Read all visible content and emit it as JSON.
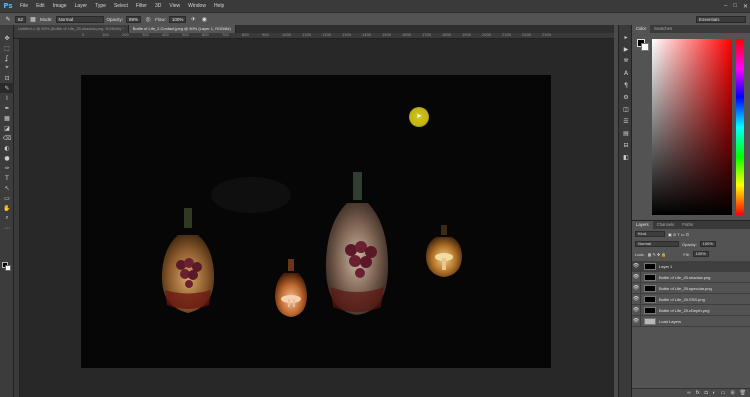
{
  "menubar": {
    "logo": "Ps",
    "items": [
      "File",
      "Edit",
      "Image",
      "Layer",
      "Type",
      "Select",
      "Filter",
      "3D",
      "View",
      "Window",
      "Help"
    ]
  },
  "options": {
    "brush_size": "62",
    "mode_label": "Mode:",
    "mode_value": "Normal",
    "opacity_label": "Opacity:",
    "opacity_value": "89%",
    "flow_label": "Flow:",
    "flow_value": "100%",
    "workspace": "Essentials"
  },
  "tabs": [
    "Untitled-1 @ 50% (Bottle of Life_25.shadow.png, RGB/8#) *",
    "Bottle of Life_2.Contact.jpeg @ 50% (Layer 1, RGB/8#)"
  ],
  "ruler_top": [
    "0",
    "50",
    "100",
    "150",
    "200",
    "250",
    "300",
    "350",
    "400",
    "450",
    "500",
    "550",
    "600",
    "650",
    "700",
    "750",
    "800",
    "850",
    "900",
    "950",
    "1000",
    "1050",
    "1100",
    "1150",
    "1200",
    "1250",
    "1300",
    "1350",
    "1400",
    "1450",
    "1500",
    "1550",
    "1600",
    "1650",
    "1700",
    "1750",
    "1800",
    "1850",
    "1900",
    "1950",
    "2000",
    "2050",
    "2100",
    "2150",
    "2200",
    "2250",
    "2300"
  ],
  "tools": [
    "✥",
    "⬚",
    "ʆ",
    "⌖",
    "⊡",
    "✎",
    "⌇",
    "✒",
    "▦",
    "◪",
    "⌫",
    "◐",
    "●",
    "✑",
    "T",
    "↖",
    "▭",
    "✋",
    "⌕",
    "⋯"
  ],
  "dock": [
    "▸",
    "▶",
    "⛯",
    "A",
    "¶",
    "⚙",
    "◫",
    "☰",
    "▤",
    "⊟",
    "◧"
  ],
  "color_panel": {
    "tab_color": "Color",
    "tab_swatches": "Swatches"
  },
  "layers_panel": {
    "tab_layers": "Layers",
    "tab_channels": "Channels",
    "tab_paths": "Paths",
    "kind_label": "Kind",
    "blend_mode": "Normal",
    "opacity_label": "Opacity:",
    "opacity_value": "100%",
    "lock_label": "Lock:",
    "fill_label": "Fill:",
    "fill_value": "100%",
    "layers": [
      {
        "name": "Layer 1",
        "active": true,
        "thumb": "dark"
      },
      {
        "name": "Bottle of Life_25.shadow.png",
        "active": false,
        "thumb": "dark"
      },
      {
        "name": "Bottle of Life_25.specular.png",
        "active": false,
        "thumb": "dark"
      },
      {
        "name": "Bottle of Life_25.SSS.png",
        "active": false,
        "thumb": "dark"
      },
      {
        "name": "Bottle of Life_25.zDepth.png",
        "active": false,
        "thumb": "dark"
      },
      {
        "name": "Load Layers",
        "active": false,
        "thumb": "light"
      }
    ]
  },
  "colors": {
    "accent_cursor": "#d6c618",
    "panel_bg": "#535353",
    "app_bg": "#282828"
  }
}
